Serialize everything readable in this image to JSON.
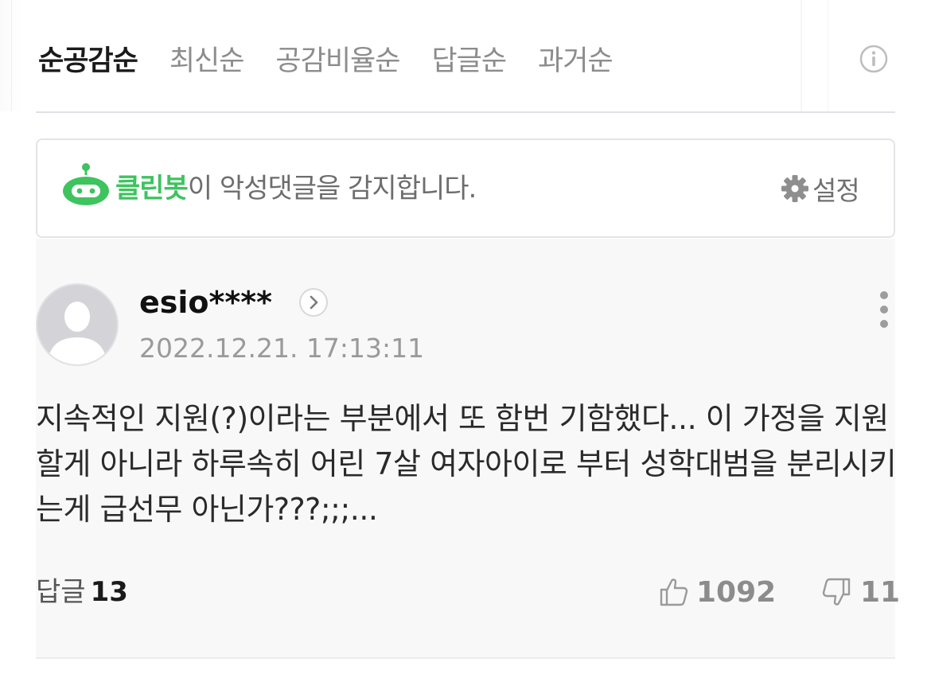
{
  "sort_tabs": [
    {
      "label": "순공감순",
      "active": true
    },
    {
      "label": "최신순",
      "active": false
    },
    {
      "label": "공감비율순",
      "active": false
    },
    {
      "label": "답글순",
      "active": false
    },
    {
      "label": "과거순",
      "active": false
    }
  ],
  "info_icon": "info-circle-icon",
  "cleanbot": {
    "icon": "robot-icon",
    "name": "클린봇",
    "message": "이 악성댓글을 감지합니다.",
    "settings_icon": "gear-icon",
    "settings_label": "설정",
    "accent_color": "#3ec35f"
  },
  "comment": {
    "username": "esio****",
    "timestamp": "2022.12.21. 17:13:11",
    "text": "지속적인 지원(?)이라는 부분에서 또 함번 기함했다... 이 가정을 지원할게 아니라 하루속히 어린 7살 여자아이로 부터 성학대범을 분리시키는게 급선무 아닌가???;;;...",
    "reply_label": "답글",
    "reply_count": "13",
    "like_count": "1092",
    "dislike_count": "11"
  },
  "colors": {
    "muted_text": "#8c8c8c",
    "comment_bg": "#f8f8f8"
  }
}
